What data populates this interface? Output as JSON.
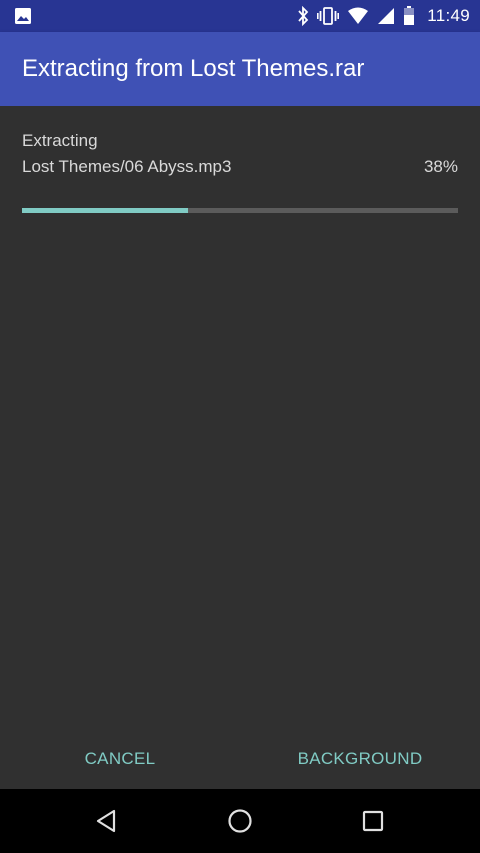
{
  "status_bar": {
    "time": "11:49",
    "left_icon": "image-notification-icon",
    "icons": [
      "bluetooth-icon",
      "vibrate-icon",
      "wifi-icon",
      "signal-icon",
      "battery-icon"
    ],
    "background_color": "#283593"
  },
  "app_bar": {
    "title": "Extracting from Lost Themes.rar",
    "color": "#3f51b5"
  },
  "progress": {
    "label": "Extracting",
    "file": "Lost Themes/06 Abyss.mp3",
    "percent_text": "38%",
    "value": 0.38,
    "accent_color": "#80cbc4"
  },
  "actions": {
    "cancel_label": "CANCEL",
    "background_label": "BACKGROUND"
  },
  "nav_bar": {
    "buttons": [
      "back-icon",
      "home-icon",
      "recents-icon"
    ]
  }
}
